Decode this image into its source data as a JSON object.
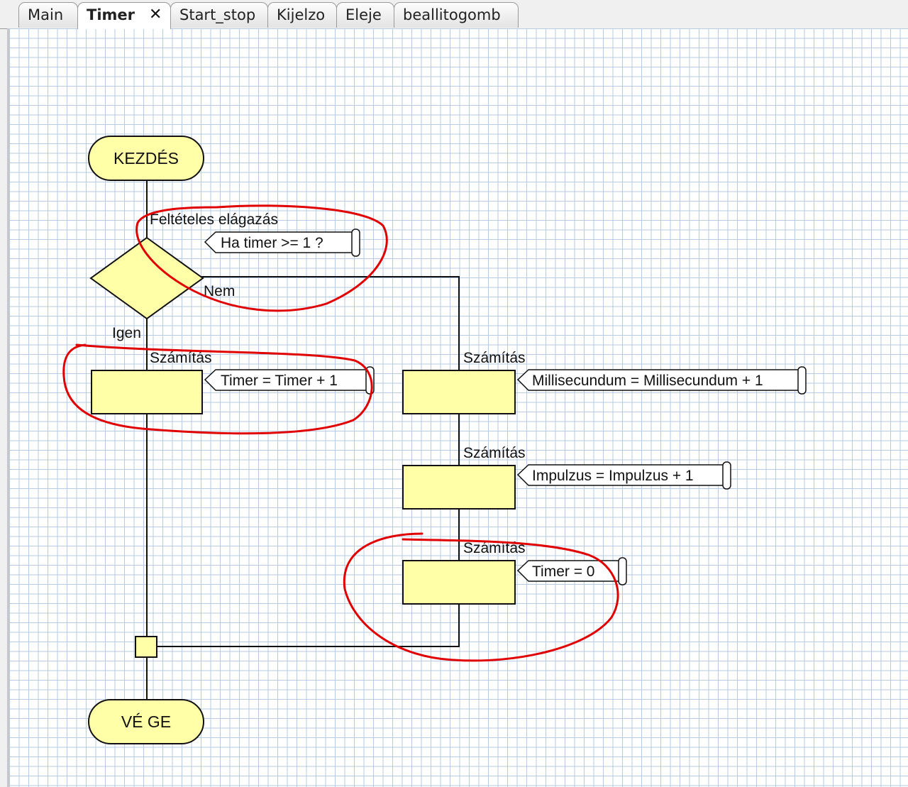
{
  "tabs": [
    {
      "label": "Main",
      "active": false
    },
    {
      "label": "Timer",
      "active": true
    },
    {
      "label": "Start_stop",
      "active": false
    },
    {
      "label": "Kijelzo",
      "active": false
    },
    {
      "label": "Eleje",
      "active": false
    },
    {
      "label": "beallitogomb",
      "active": false
    }
  ],
  "flowchart": {
    "start_label": "KEZDÉS",
    "end_label": "VÉ GE",
    "decision": {
      "title": "Feltételes elágazás",
      "condition": "Ha timer >= 1 ?",
      "no_label": "Nem",
      "yes_label": "Igen"
    },
    "yes_branch": [
      {
        "title": "Számítás",
        "expression": "Timer = Timer + 1"
      }
    ],
    "no_branch": [
      {
        "title": "Számítás",
        "expression": "Millisecundum = Millisecundum + 1"
      },
      {
        "title": "Számítás",
        "expression": "Impulzus = Impulzus + 1"
      },
      {
        "title": "Számítás",
        "expression": "Timer = 0"
      }
    ]
  },
  "colors": {
    "block_fill": "#ffffa8",
    "grid_line": "#b7cbe6",
    "annotation_red": "#e00000"
  },
  "annotations": "red hand-drawn circles around the decision, the Timer = Timer + 1 block and the Timer = 0 block"
}
